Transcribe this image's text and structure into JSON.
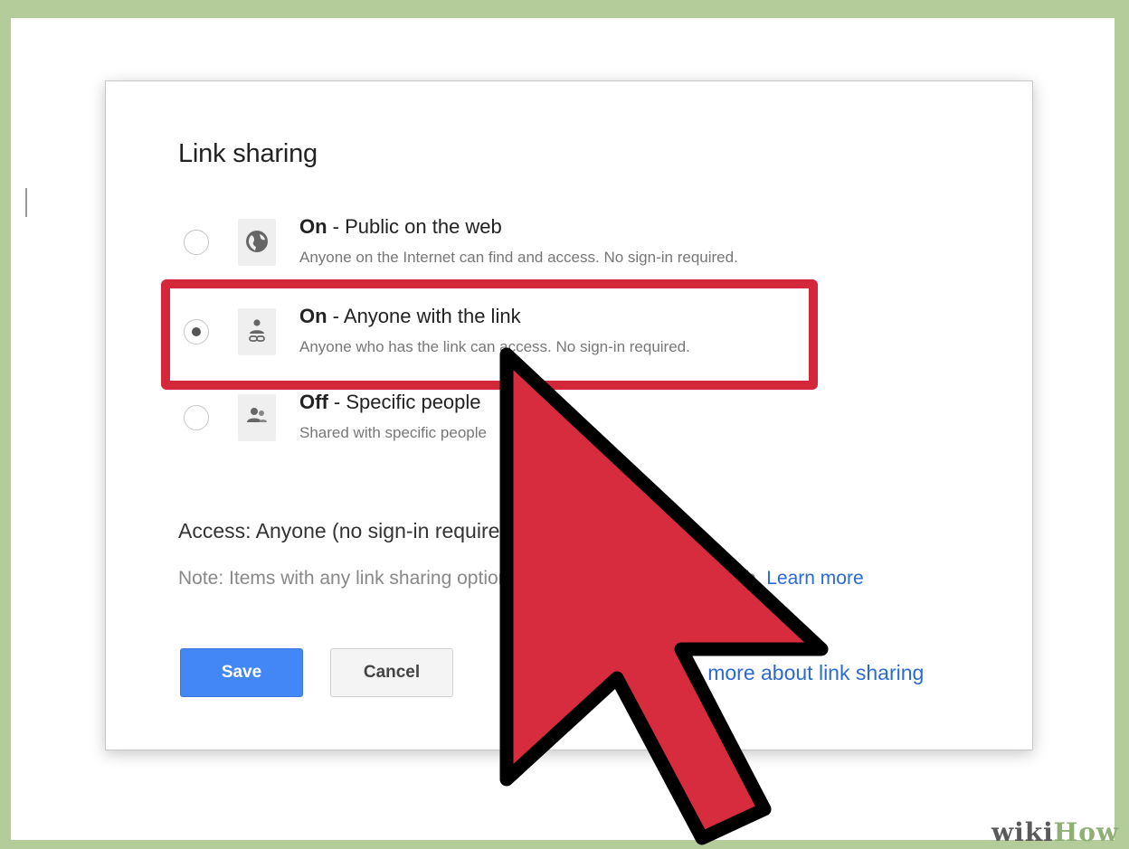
{
  "dialog": {
    "title": "Link sharing",
    "options": [
      {
        "state": "On",
        "label": " - Public on the web",
        "description": "Anyone on the Internet can find and access. No sign-in required.",
        "icon": "globe-icon",
        "selected": false
      },
      {
        "state": "On",
        "label": " - Anyone with the link",
        "description": "Anyone who has the link can access. No sign-in required.",
        "icon": "person-link-icon",
        "selected": true
      },
      {
        "state": "Off",
        "label": " - Specific people",
        "description": "Shared with specific people",
        "icon": "people-icon",
        "selected": false
      }
    ],
    "access_text": "Access:  Anyone (no sign-in required)",
    "note_text": "Note: Items with any link sharing option can be published on the web.",
    "note_link": "Learn more",
    "save_label": "Save",
    "cancel_label": "Cancel",
    "learn_sharing_link": "Learn more about link sharing"
  },
  "annotations": {
    "highlight_color": "#d3283a",
    "cursor_color": "#d72c3e",
    "cursor_icon": "arrow-cursor-icon"
  },
  "watermark": {
    "part1": "wiki",
    "part2": "How"
  }
}
